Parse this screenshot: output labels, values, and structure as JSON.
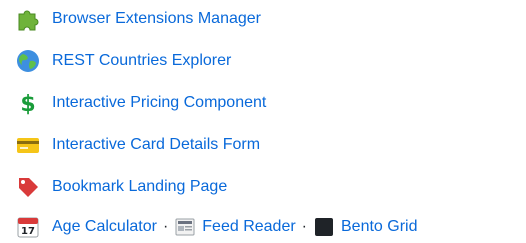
{
  "projects": [
    {
      "label": "Browser Extensions Manager",
      "icon": "puzzle-piece-icon"
    },
    {
      "label": "REST Countries Explorer",
      "icon": "globe-icon"
    },
    {
      "label": "Interactive Pricing Component",
      "icon": "dollar-sign-icon"
    },
    {
      "label": "Interactive Card Details Form",
      "icon": "credit-card-icon"
    },
    {
      "label": "Bookmark Landing Page",
      "icon": "bookmark-icon"
    }
  ],
  "last_row": {
    "items": [
      {
        "label": "Age Calculator",
        "icon": "calendar-icon"
      },
      {
        "label": "Feed Reader",
        "icon": "newspaper-icon"
      },
      {
        "label": "Bento Grid",
        "icon": "black-square-icon"
      }
    ],
    "separator": "·"
  },
  "colors": {
    "link": "#0969da",
    "puzzle_green": "#6fb33a",
    "dollar_green": "#1a9c3a",
    "card_yellow": "#f5c518",
    "bookmark_red": "#d93a3a"
  }
}
